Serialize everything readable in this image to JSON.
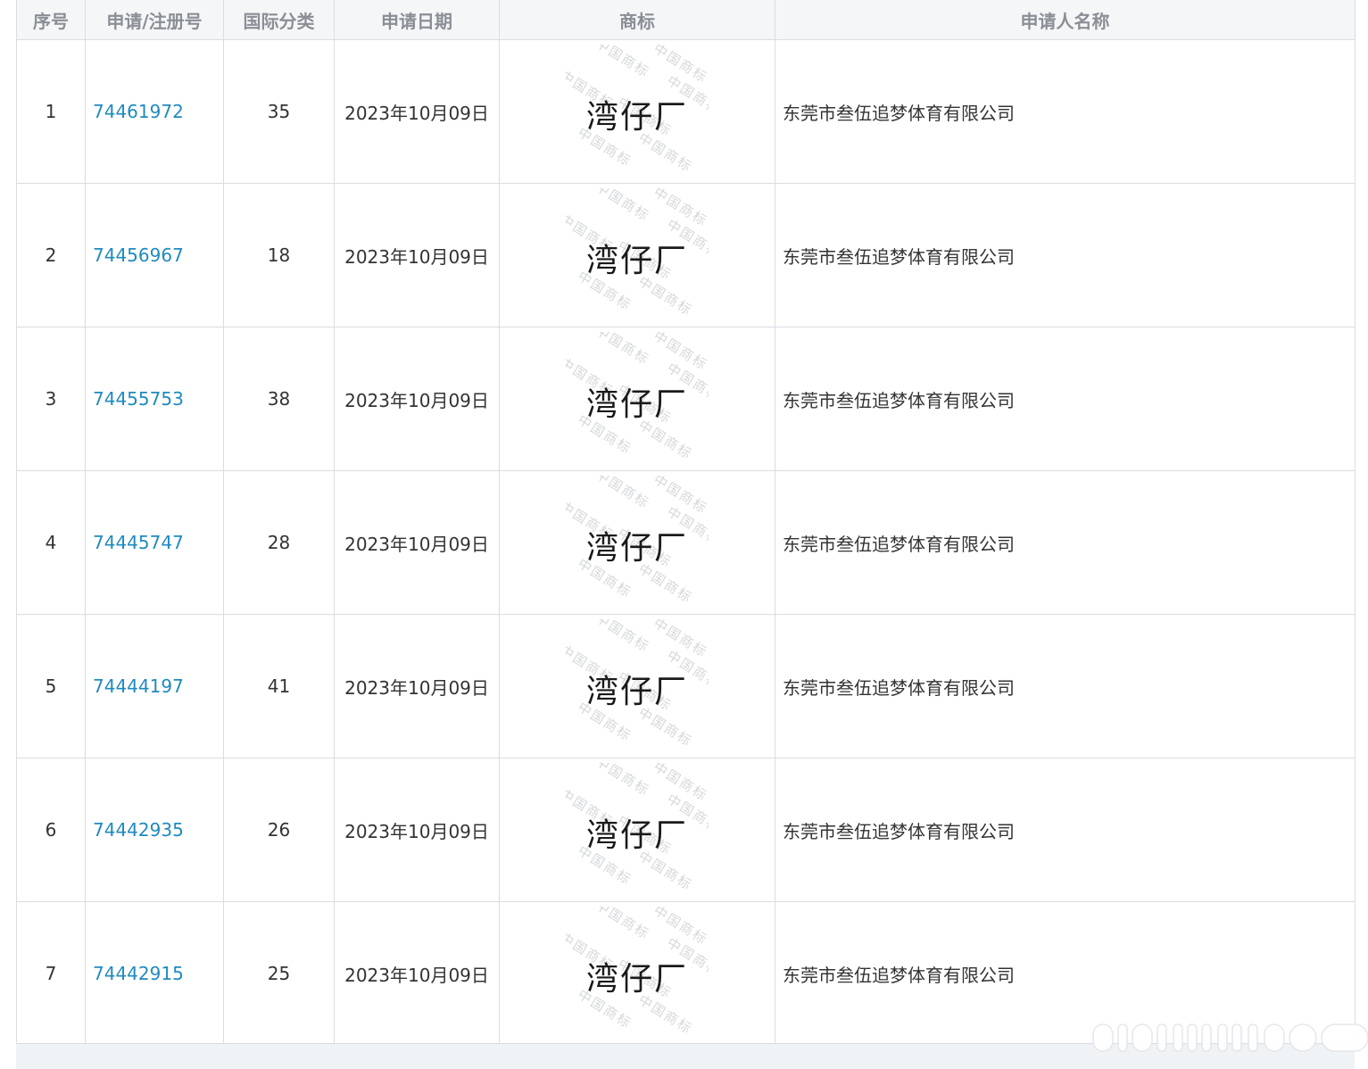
{
  "table": {
    "headers": {
      "index": "序号",
      "app_no": "申请/注册号",
      "intl_class": "国际分类",
      "app_date": "申请日期",
      "trademark": "商标",
      "applicant": "申请人名称"
    },
    "rows": [
      {
        "index": "1",
        "app_no": "74461972",
        "intl_class": "35",
        "app_date": "2023年10月09日",
        "trademark": "湾仔厂",
        "applicant": "东莞市叁伍追梦体育有限公司"
      },
      {
        "index": "2",
        "app_no": "74456967",
        "intl_class": "18",
        "app_date": "2023年10月09日",
        "trademark": "湾仔厂",
        "applicant": "东莞市叁伍追梦体育有限公司"
      },
      {
        "index": "3",
        "app_no": "74455753",
        "intl_class": "38",
        "app_date": "2023年10月09日",
        "trademark": "湾仔厂",
        "applicant": "东莞市叁伍追梦体育有限公司"
      },
      {
        "index": "4",
        "app_no": "74445747",
        "intl_class": "28",
        "app_date": "2023年10月09日",
        "trademark": "湾仔厂",
        "applicant": "东莞市叁伍追梦体育有限公司"
      },
      {
        "index": "5",
        "app_no": "74444197",
        "intl_class": "41",
        "app_date": "2023年10月09日",
        "trademark": "湾仔厂",
        "applicant": "东莞市叁伍追梦体育有限公司"
      },
      {
        "index": "6",
        "app_no": "74442935",
        "intl_class": "26",
        "app_date": "2023年10月09日",
        "trademark": "湾仔厂",
        "applicant": "东莞市叁伍追梦体育有限公司"
      },
      {
        "index": "7",
        "app_no": "74442915",
        "intl_class": "25",
        "app_date": "2023年10月09日",
        "trademark": "湾仔厂",
        "applicant": "东莞市叁伍追梦体育有限公司"
      }
    ],
    "watermark_text": "中国商标"
  },
  "colors": {
    "link": "#1f8ac0",
    "header_bg": "#f5f6f7",
    "header_text": "#8a8f96",
    "border": "#d9dde2",
    "page_bg": "#f0f3f6"
  }
}
